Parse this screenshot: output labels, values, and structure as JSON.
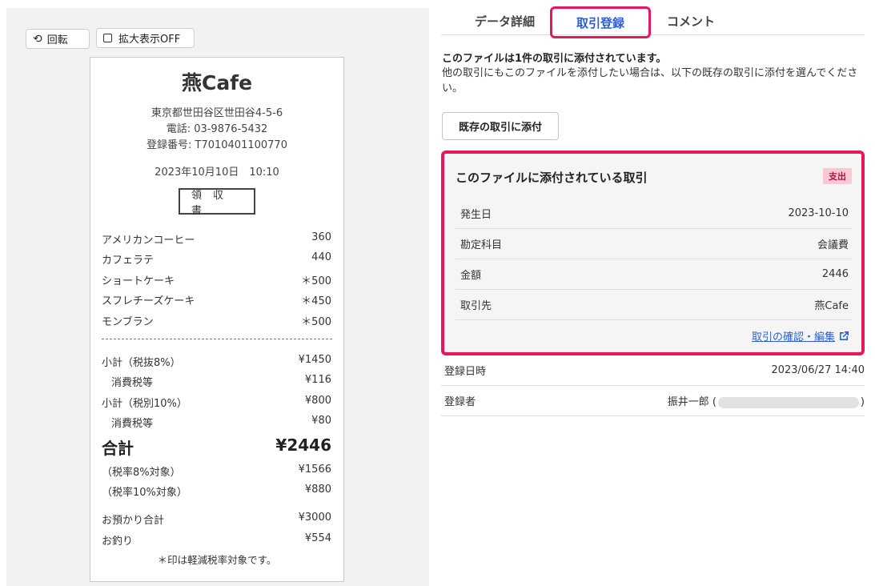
{
  "toolbar": {
    "rotate_label": "回転",
    "zoom_label": "拡大表示OFF"
  },
  "receipt": {
    "store_name": "燕Cafe",
    "address": "東京都世田谷区世田谷4-5-6",
    "phone": "電話: 03-9876-5432",
    "registration": "登録番号: T7010401100770",
    "datetime": "2023年10月10日　10:10",
    "doc_type": "領収書",
    "items": [
      {
        "name": "アメリカンコーヒー",
        "price": "360"
      },
      {
        "name": "カフェラテ",
        "price": "440"
      },
      {
        "name": "ショートケーキ",
        "price": "＊500"
      },
      {
        "name": "スフレチーズケーキ",
        "price": "＊450"
      },
      {
        "name": "モンブラン",
        "price": "＊500"
      }
    ],
    "subtotal8_label": "小計（税抜8%）",
    "subtotal8_value": "¥1450",
    "tax8_label": "消費税等",
    "tax8_value": "¥116",
    "subtotal10_label": "小計（税別10%）",
    "subtotal10_value": "¥800",
    "tax10_label": "消費税等",
    "tax10_value": "¥80",
    "total_label": "合計",
    "total_value": "¥2446",
    "rate8_label": "（税率8%対象）",
    "rate8_value": "¥1566",
    "rate10_label": "（税率10%対象）",
    "rate10_value": "¥880",
    "deposit_label": "お預かり合計",
    "deposit_value": "¥3000",
    "change_label": "お釣り",
    "change_value": "¥554",
    "note": "＊印は軽減税率対象です。"
  },
  "tabs": {
    "data_detail": "データ詳細",
    "transaction_register": "取引登録",
    "comment": "コメント"
  },
  "info": {
    "bold": "このファイルは1件の取引に添付されています。",
    "text": "他の取引にもこのファイルを添付したい場合は、以下の既存の取引に添付を選んでください。"
  },
  "attach_button": "既存の取引に添付",
  "card": {
    "title": "このファイルに添付されている取引",
    "badge": "支出",
    "rows": [
      {
        "label": "発生日",
        "value": "2023-10-10"
      },
      {
        "label": "勘定科目",
        "value": "会議費"
      },
      {
        "label": "金額",
        "value": "2446"
      },
      {
        "label": "取引先",
        "value": "燕Cafe"
      }
    ],
    "link": "取引の確認・編集"
  },
  "meta": {
    "registered_at_label": "登録日時",
    "registered_at_value": "2023/06/27 14:40",
    "registrant_label": "登録者",
    "registrant_name": "振井一郎 (",
    "registrant_close": ")"
  }
}
